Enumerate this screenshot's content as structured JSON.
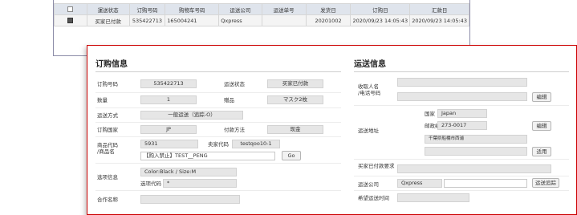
{
  "list": {
    "headers": [
      "運送状态",
      "订购号码",
      "购物车号码",
      "运送公司",
      "运送单号",
      "发货日",
      "订购日",
      "汇款日"
    ],
    "row": [
      "买家已付款",
      "535422713",
      "165004241",
      "Qxpress",
      "",
      "20201002",
      "2020/09/23 14:05:43",
      "2020/09/23 14:05:43"
    ]
  },
  "order": {
    "title": "订购信息",
    "order_no_label": "订购号码",
    "order_no": "535422713",
    "status_label": "运送状态",
    "status": "买家已付款",
    "qty_label": "数量",
    "qty": "1",
    "bonus_label": "赠品",
    "bonus": "マスク2枚",
    "ship_method_label": "运送方式",
    "ship_method": "一般运送（追踪-O）",
    "country_label": "订购国家",
    "country": "JP",
    "payment_label": "付款方法",
    "payment": "现金",
    "product_label": "商品代码\n/商品名",
    "product_code_prefix": "5931",
    "seller_code_label": "卖家代码",
    "seller_code": "testqoo10-1",
    "product_name": "【购入禁止】TEST__PENG",
    "go": "Go",
    "option_label": "选项信息",
    "option_value": "Color:Black / Size:M",
    "option_code_label": "选项代码",
    "option_code": "*",
    "partner_label": "合作名称"
  },
  "shipping": {
    "title": "运送信息",
    "recipient_label": "收取人名\n/电话号码",
    "edit": "编辑",
    "address_label": "运送地址",
    "country_label": "国家",
    "country": "Japan",
    "postal_label": "邮政编码",
    "postal": "273-0017",
    "address_line": "千葉県船橋市西浦",
    "apply": "适用",
    "buyer_req_label": "买家已付款要求",
    "carrier_label": "运送公司",
    "carrier": "Qxpress",
    "tracking_btn": "运送追踪",
    "desired_time_label": "希望运送时间"
  }
}
